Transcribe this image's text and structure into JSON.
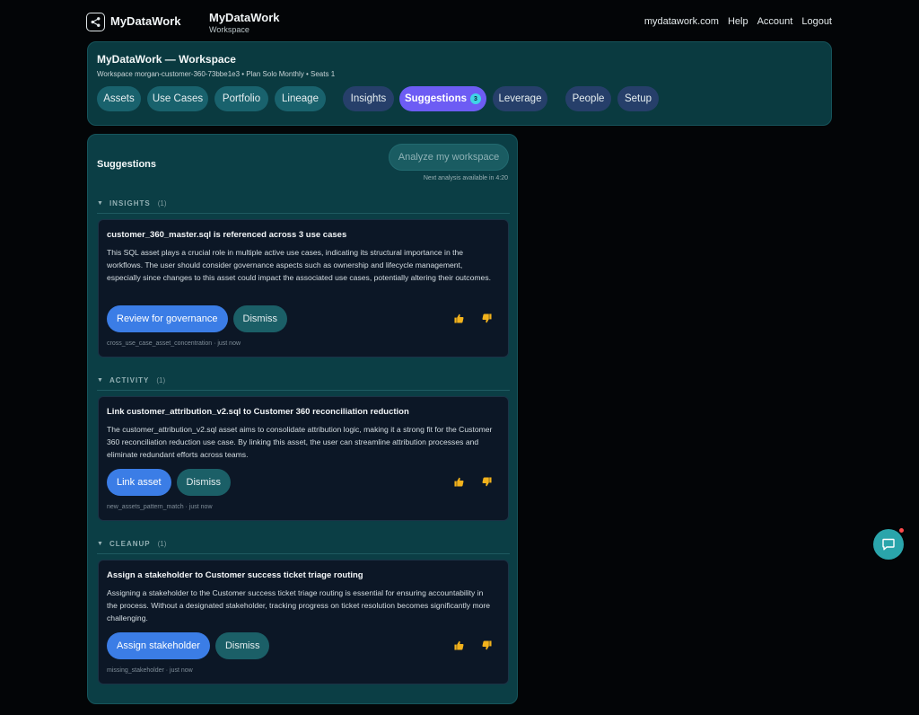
{
  "topbar": {
    "brand": "MyDataWork",
    "workspace_title": "MyDataWork",
    "workspace_sub": "Workspace",
    "nav": [
      "mydatawork.com",
      "Help",
      "Account",
      "Logout"
    ]
  },
  "header": {
    "title": "MyDataWork — Workspace",
    "meta": "Workspace morgan-customer-360-73bbe1e3 • Plan Solo Monthly • Seats 1",
    "tabs": [
      {
        "label": "Assets"
      },
      {
        "label": "Use Cases"
      },
      {
        "label": "Portfolio"
      },
      {
        "label": "Lineage"
      },
      {
        "label": "Insights"
      },
      {
        "label": "Suggestions",
        "badge": "3"
      },
      {
        "label": "Leverage"
      },
      {
        "label": "People"
      },
      {
        "label": "Setup"
      }
    ]
  },
  "suggestions": {
    "title": "Suggestions",
    "analyze_label": "Analyze my workspace",
    "next_note": "Next analysis available in 4:20",
    "sections": [
      {
        "name": "INSIGHTS",
        "count": "(1)",
        "card": {
          "title": "customer_360_master.sql is referenced across 3 use cases",
          "body": "This SQL asset plays a crucial role in multiple active use cases, indicating its structural importance in the workflows. The user should consider governance aspects such as ownership and lifecycle management, especially since changes to this asset could impact the associated use cases, potentially altering their outcomes.",
          "primary": "Review for governance",
          "dismiss": "Dismiss",
          "foot": "cross_use_case_asset_concentration · just now"
        }
      },
      {
        "name": "ACTIVITY",
        "count": "(1)",
        "card": {
          "title": "Link customer_attribution_v2.sql to Customer 360 reconciliation reduction",
          "body": "The customer_attribution_v2.sql asset aims to consolidate attribution logic, making it a strong fit for the Customer 360 reconciliation reduction use case. By linking this asset, the user can streamline attribution processes and eliminate redundant efforts across teams.",
          "primary": "Link asset",
          "dismiss": "Dismiss",
          "foot": "new_assets_pattern_match · just now"
        }
      },
      {
        "name": "CLEANUP",
        "count": "(1)",
        "card": {
          "title": "Assign a stakeholder to Customer success ticket triage routing",
          "body": "Assigning a stakeholder to the Customer success ticket triage routing is essential for ensuring accountability in the process. Without a designated stakeholder, tracking progress on ticket resolution becomes significantly more challenging.",
          "primary": "Assign stakeholder",
          "dismiss": "Dismiss",
          "foot": "missing_stakeholder · just now"
        }
      }
    ]
  },
  "colors": {
    "accent": "#6d5cf4",
    "primary_button": "#3b7de6",
    "panel": "#0b3e45",
    "thumbs": "#f2b21c"
  }
}
